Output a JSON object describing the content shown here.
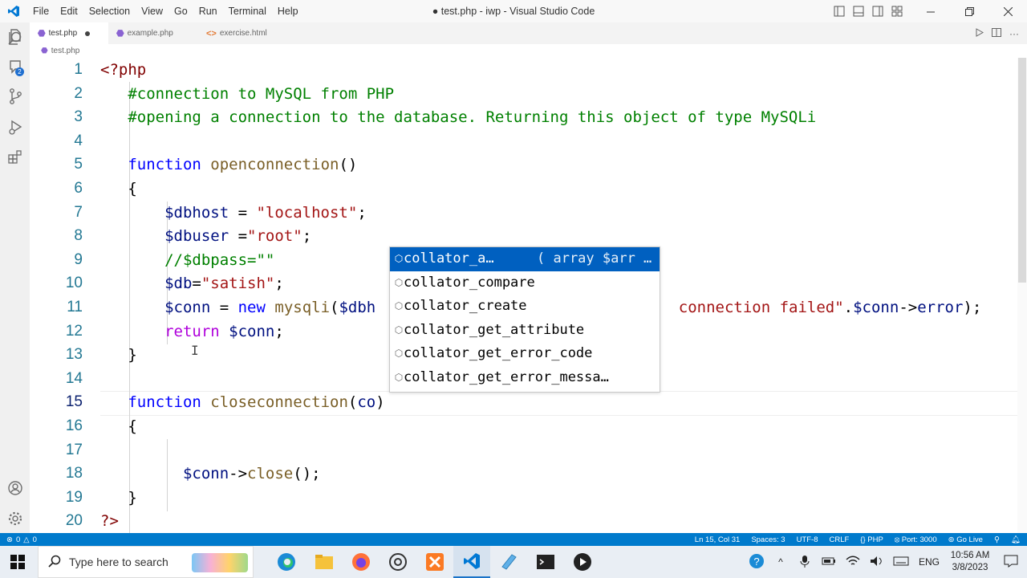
{
  "titlebar": {
    "menu": [
      "File",
      "Edit",
      "Selection",
      "View",
      "Go",
      "Run",
      "Terminal",
      "Help"
    ],
    "window_title": "● test.php - iwp - Visual Studio Code"
  },
  "tabs": [
    {
      "label": "test.php",
      "active": true
    },
    {
      "label": "example.php",
      "active": false
    },
    {
      "label": "exercise.html",
      "active": false
    }
  ],
  "breadcrumb": "test.php",
  "code": [
    {
      "n": "1",
      "parts": [
        [
          "tag",
          "<?php"
        ]
      ]
    },
    {
      "n": "2",
      "parts": [
        [
          "sp",
          "   "
        ],
        [
          "cm",
          "#connection to MySQL from PHP"
        ]
      ]
    },
    {
      "n": "3",
      "parts": [
        [
          "sp",
          "   "
        ],
        [
          "cm",
          "#opening a connection to the database. Returning this object of type MySQLi"
        ]
      ]
    },
    {
      "n": "4",
      "parts": []
    },
    {
      "n": "5",
      "parts": [
        [
          "sp",
          "   "
        ],
        [
          "kw",
          "function"
        ],
        [
          "tx",
          " "
        ],
        [
          "fn",
          "openconnection"
        ],
        [
          "tx",
          "()"
        ]
      ]
    },
    {
      "n": "6",
      "parts": [
        [
          "sp",
          "   "
        ],
        [
          "tx",
          "{"
        ]
      ]
    },
    {
      "n": "7",
      "parts": [
        [
          "sp",
          "       "
        ],
        [
          "vr",
          "$dbhost"
        ],
        [
          "tx",
          " = "
        ],
        [
          "st",
          "\"localhost\""
        ],
        [
          "tx",
          ";"
        ]
      ]
    },
    {
      "n": "8",
      "parts": [
        [
          "sp",
          "       "
        ],
        [
          "vr",
          "$dbuser"
        ],
        [
          "tx",
          " ="
        ],
        [
          "st",
          "\"root\""
        ],
        [
          "tx",
          ";"
        ]
      ]
    },
    {
      "n": "9",
      "parts": [
        [
          "sp",
          "       "
        ],
        [
          "cm",
          "//$dbpass=\"\""
        ]
      ]
    },
    {
      "n": "10",
      "parts": [
        [
          "sp",
          "       "
        ],
        [
          "vr",
          "$db"
        ],
        [
          "tx",
          "="
        ],
        [
          "st",
          "\"satish\""
        ],
        [
          "tx",
          ";"
        ]
      ]
    },
    {
      "n": "11",
      "parts": [
        [
          "sp",
          "       "
        ],
        [
          "vr",
          "$conn"
        ],
        [
          "tx",
          " = "
        ],
        [
          "kw",
          "new"
        ],
        [
          "tx",
          " "
        ],
        [
          "fn",
          "mysqli"
        ],
        [
          "tx",
          "("
        ],
        [
          "vr",
          "$dbh"
        ],
        [
          "tx",
          "                                 "
        ],
        [
          "st",
          "connection failed\""
        ],
        [
          "tx",
          "."
        ],
        [
          "vr",
          "$conn"
        ],
        [
          "tx",
          "->"
        ],
        [
          "vr",
          "error"
        ],
        [
          "tx",
          ");"
        ]
      ]
    },
    {
      "n": "12",
      "parts": [
        [
          "sp",
          "       "
        ],
        [
          "kw2",
          "return"
        ],
        [
          "tx",
          " "
        ],
        [
          "vr",
          "$conn"
        ],
        [
          "tx",
          ";"
        ]
      ]
    },
    {
      "n": "13",
      "parts": [
        [
          "sp",
          "   "
        ],
        [
          "tx",
          "}"
        ]
      ]
    },
    {
      "n": "14",
      "parts": []
    },
    {
      "n": "15",
      "parts": [
        [
          "sp",
          "   "
        ],
        [
          "kw",
          "function"
        ],
        [
          "tx",
          " "
        ],
        [
          "fn",
          "closeconnection"
        ],
        [
          "tx",
          "("
        ],
        [
          "vr",
          "co"
        ],
        [
          "tx",
          ")"
        ]
      ]
    },
    {
      "n": "16",
      "parts": [
        [
          "sp",
          "   "
        ],
        [
          "tx",
          "{"
        ]
      ]
    },
    {
      "n": "17",
      "parts": []
    },
    {
      "n": "18",
      "parts": [
        [
          "sp",
          "         "
        ],
        [
          "vr",
          "$conn"
        ],
        [
          "tx",
          "->"
        ],
        [
          "fn",
          "close"
        ],
        [
          "tx",
          "();"
        ]
      ]
    },
    {
      "n": "19",
      "parts": [
        [
          "sp",
          "   "
        ],
        [
          "tx",
          "}"
        ]
      ]
    },
    {
      "n": "20",
      "parts": [
        [
          "tag",
          "?>"
        ]
      ]
    }
  ],
  "suggestions": [
    {
      "label": "collator_a…",
      "detail": "( array $arr …",
      "selected": true
    },
    {
      "label": "collator_compare",
      "selected": false
    },
    {
      "label": "collator_create",
      "selected": false
    },
    {
      "label": "collator_get_attribute",
      "selected": false
    },
    {
      "label": "collator_get_error_code",
      "selected": false
    },
    {
      "label": "collator_get_error_messa…",
      "selected": false
    }
  ],
  "statusbar": {
    "errors": "0",
    "warnings": "0",
    "position": "Ln 15, Col 31",
    "spaces": "Spaces: 3",
    "encoding": "UTF-8",
    "eol": "CRLF",
    "language": "PHP",
    "port": "Port: 3000",
    "golive": "Go Live"
  },
  "taskbar": {
    "search_placeholder": "Type here to search",
    "language": "ENG",
    "time": "10:56 AM",
    "date": "3/8/2023"
  },
  "colors": {
    "accent": "#007acc",
    "selection": "#0060c0"
  }
}
